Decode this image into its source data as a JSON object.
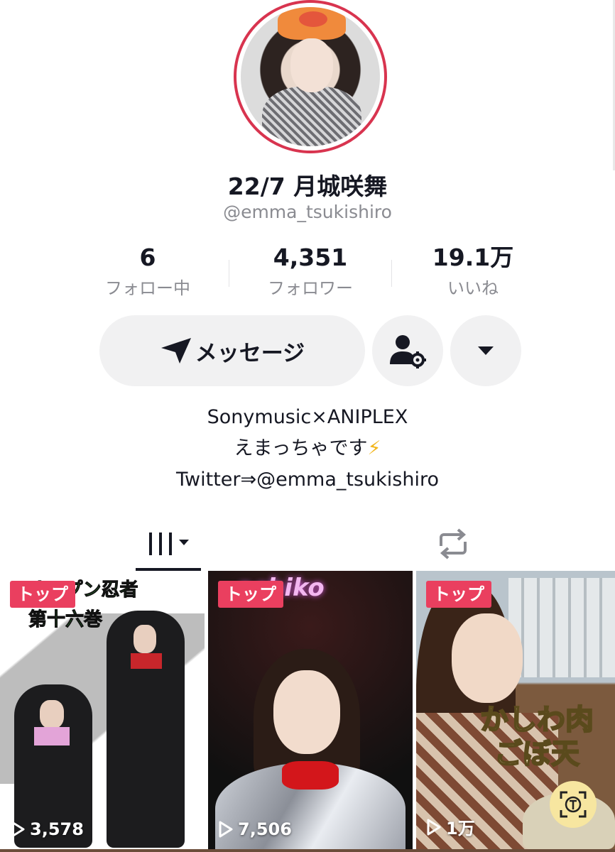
{
  "profile": {
    "display_name": "22/7 月城咲舞",
    "username": "@emma_tsukishiro",
    "ring_color": "#d8344f"
  },
  "stats": [
    {
      "value": "6",
      "label": "フォロー中"
    },
    {
      "value": "4,351",
      "label": "フォロワー"
    },
    {
      "value": "19.1万",
      "label": "いいね"
    }
  ],
  "actions": {
    "message_label": "メッセージ",
    "message_icon": "send-icon",
    "add_friend_icon": "user-settings-icon",
    "more_icon": "caret-down-icon"
  },
  "bio": {
    "line1": "Sonymusic×ANIPLEX",
    "line2": "えまっちゃです",
    "line2_emoji": "⚡",
    "line3": "Twitter⇒@emma_tsukishiro"
  },
  "tabs": [
    {
      "icon": "videos-grid-icon",
      "active": true
    },
    {
      "icon": "repost-icon",
      "active": false
    }
  ],
  "videos": [
    {
      "badge": "トップ",
      "views": "3,578",
      "overlay_a": "オープン忍者",
      "overlay_b": "第十六巻"
    },
    {
      "badge": "トップ",
      "views": "7,506",
      "overlay": "achiko"
    },
    {
      "badge": "トップ",
      "views": "1万",
      "caption_a": "かしわ肉",
      "caption_b": "ごぼ天"
    }
  ],
  "colors": {
    "badge": "#ea3f5f",
    "button_bg": "#f1f1f2",
    "secondary_text": "#8a8b91"
  }
}
